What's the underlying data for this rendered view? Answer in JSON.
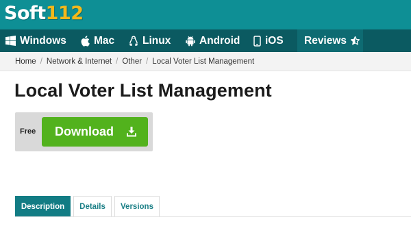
{
  "header": {
    "logo_text": "Soft",
    "logo_number": "112",
    "logo_colors": {
      "text": "#ffffff",
      "number": "#f4b81a",
      "background": "#0e8f95"
    }
  },
  "nav": {
    "items": [
      {
        "label": "Windows",
        "icon": "windows-icon"
      },
      {
        "label": "Mac",
        "icon": "apple-icon"
      },
      {
        "label": "Linux",
        "icon": "linux-icon"
      },
      {
        "label": "Android",
        "icon": "android-icon"
      },
      {
        "label": "iOS",
        "icon": "ios-icon"
      }
    ],
    "reviews": {
      "label": "Reviews",
      "icon": "star-half-icon"
    },
    "background": "#0b5a61"
  },
  "breadcrumb": {
    "items": [
      "Home",
      "Network & Internet",
      "Other"
    ],
    "current": "Local Voter List Management",
    "separator": "/"
  },
  "page": {
    "title": "Local Voter List Management"
  },
  "download": {
    "license": "Free",
    "button_label": "Download",
    "button_icon": "download-icon",
    "button_color": "#52b21d"
  },
  "tabs": {
    "items": [
      {
        "label": "Description",
        "active": true
      },
      {
        "label": "Details",
        "active": false
      },
      {
        "label": "Versions",
        "active": false
      }
    ],
    "accent": "#127c84"
  }
}
